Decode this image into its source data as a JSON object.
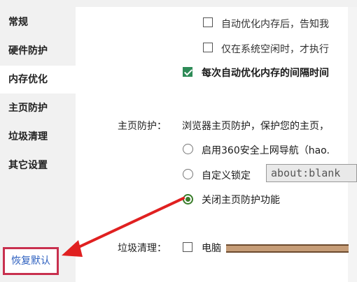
{
  "sidebar": {
    "items": [
      {
        "label": "常规"
      },
      {
        "label": "硬件防护"
      },
      {
        "label": "内存优化"
      },
      {
        "label": "主页防护"
      },
      {
        "label": "垃圾清理"
      },
      {
        "label": "其它设置"
      }
    ],
    "active_index": 2,
    "restore_label": "恢复默认"
  },
  "memory": {
    "opt_notify": {
      "label": "自动优化内存后，告知我",
      "checked": false
    },
    "opt_idle": {
      "label": "仅在系统空闲时，才执行",
      "checked": false
    },
    "opt_interval": {
      "label": "每次自动优化内存的间隔时间",
      "checked": true
    }
  },
  "homepage": {
    "section_label": "主页防护：",
    "description": "浏览器主页防护，保护您的主页，",
    "options": [
      {
        "label": "启用360安全上网导航（hao.",
        "selected": false
      },
      {
        "label": "自定义锁定",
        "selected": false
      },
      {
        "label": "关闭主页防护功能",
        "selected": true
      }
    ],
    "custom_url": "about:blank"
  },
  "cleanup": {
    "section_label": "垃圾清理：",
    "option_label": "电脑",
    "checked": false
  },
  "colors": {
    "accent_green": "#2e8b57",
    "highlight_red": "#c8304e",
    "link_blue": "#2c5fbf"
  }
}
